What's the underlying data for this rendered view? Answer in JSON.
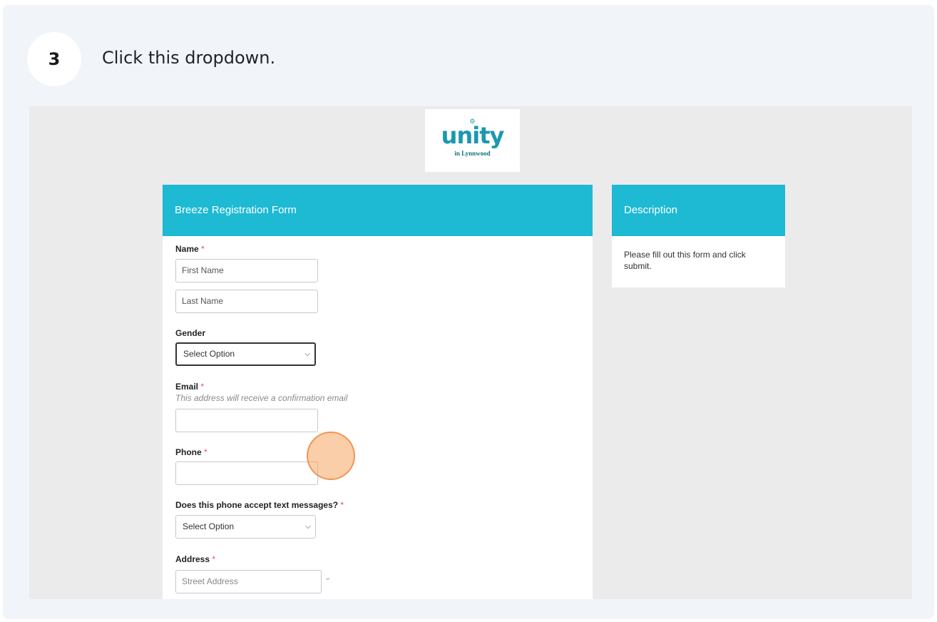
{
  "step": {
    "number": "3",
    "instruction": "Click this dropdown."
  },
  "logo": {
    "mark": "⚙",
    "wordmark": "unity",
    "subtitle": "in Lynnwood"
  },
  "form": {
    "title": "Breeze Registration Form",
    "required_mark": "*",
    "name_label": "Name",
    "first_name_placeholder": "First Name",
    "last_name_placeholder": "Last Name",
    "gender_label": "Gender",
    "gender_value": "Select Option",
    "email_label": "Email",
    "email_help": "This address will receive a confirmation email",
    "phone_label": "Phone",
    "text_label": "Does this phone accept text messages?",
    "text_value": "Select Option",
    "address_label": "Address",
    "street_placeholder": "Street Address"
  },
  "description": {
    "title": "Description",
    "text": "Please fill out this form and click submit."
  },
  "icons": {
    "dropdown": "chevron-down-icon",
    "expand": "double-chevron-down-icon"
  },
  "colors": {
    "accent": "#1eb9d3",
    "required": "#e0514f",
    "click_highlight": "#f7a564"
  }
}
